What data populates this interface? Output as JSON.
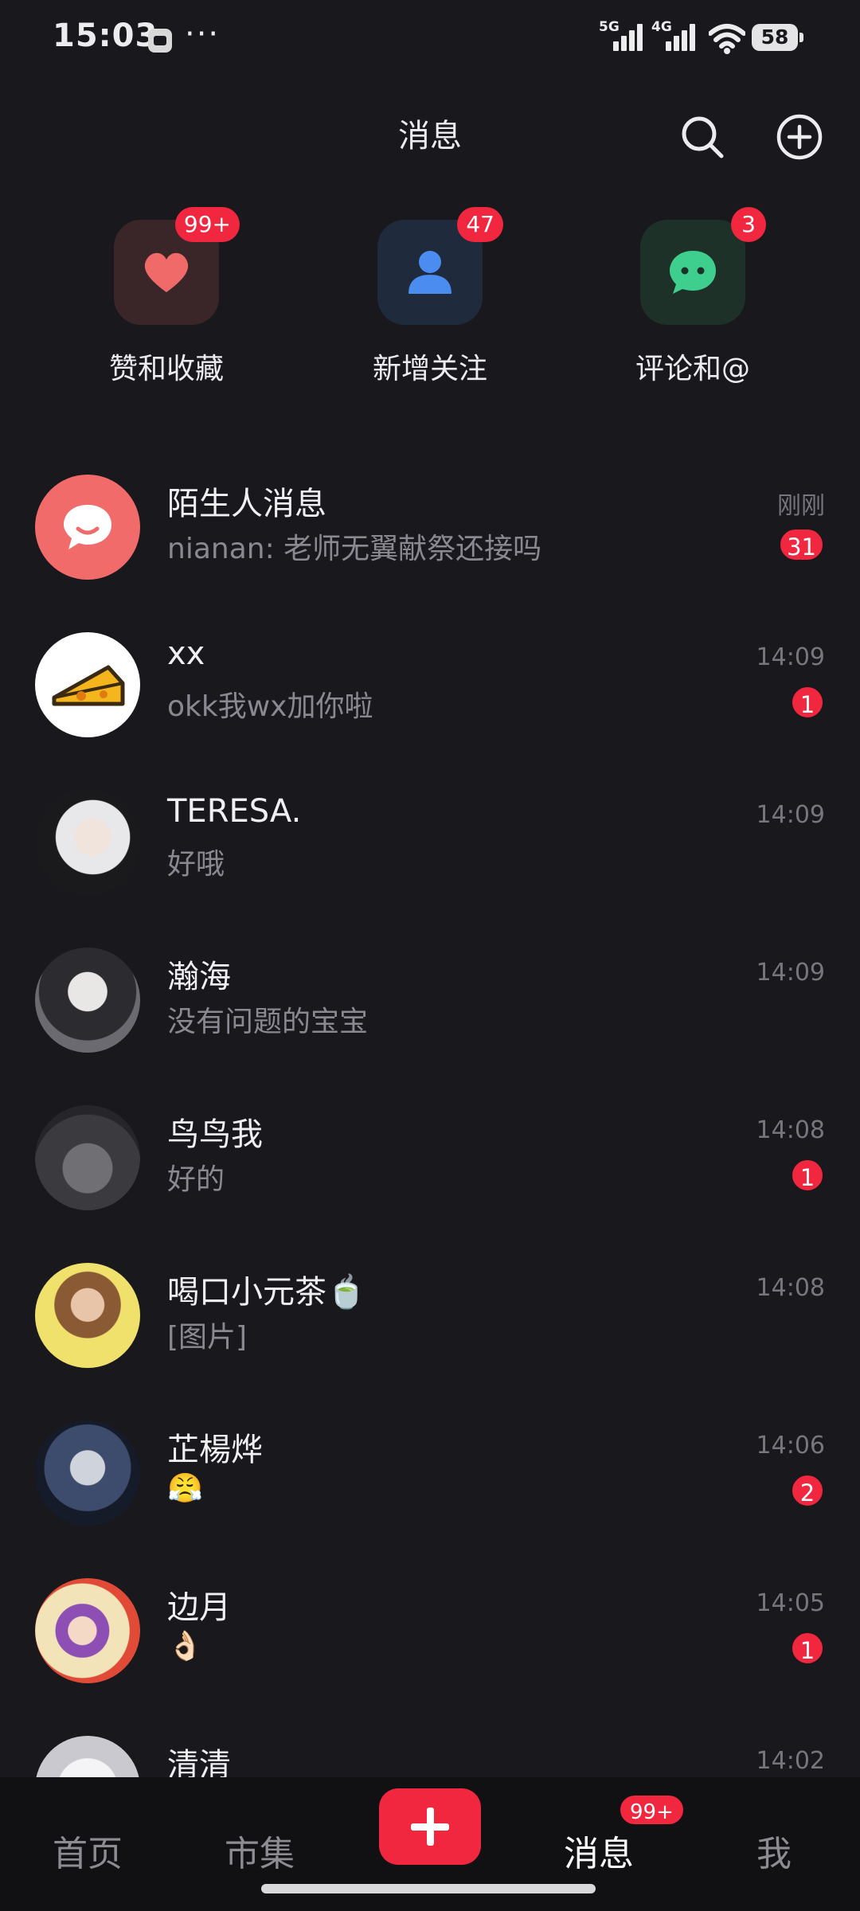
{
  "status_bar": {
    "time": "15:03",
    "dots": "···",
    "network1": "5G",
    "network2": "4G",
    "battery": "58"
  },
  "header": {
    "title": "消息",
    "search_icon": "search-icon",
    "add_icon": "plus-circle-icon"
  },
  "quick_actions": [
    {
      "label": "赞和收藏",
      "badge": "99+",
      "icon": "heart-icon",
      "color": "#f06a6a",
      "bg": "#3a2628"
    },
    {
      "label": "新增关注",
      "badge": "47",
      "icon": "person-icon",
      "color": "#4b8cf0",
      "bg": "#1f2a3c"
    },
    {
      "label": "评论和@",
      "badge": "3",
      "icon": "chat-bubble-icon",
      "color": "#3ecf8e",
      "bg": "#1d3129"
    }
  ],
  "conversations": [
    {
      "name": "陌生人消息",
      "message": "nianan: 老师无翼献祭还接吗",
      "time": "刚刚",
      "badge": "31"
    },
    {
      "name": "xx",
      "message": "okk我wx加你啦",
      "time": "14:09",
      "badge": "1"
    },
    {
      "name": "TERESA.",
      "message": "好哦",
      "time": "14:09",
      "badge": ""
    },
    {
      "name": "瀚海",
      "message": "没有问题的宝宝",
      "time": "14:09",
      "badge": ""
    },
    {
      "name": "鸟鸟我",
      "message": "好的",
      "time": "14:08",
      "badge": "1"
    },
    {
      "name": "喝口小元茶🍵",
      "message": "[图片]",
      "time": "14:08",
      "badge": ""
    },
    {
      "name": "芷楊烨",
      "message": "😤",
      "time": "14:06",
      "badge": "2"
    },
    {
      "name": "边月",
      "message": "👌🏻",
      "time": "14:05",
      "badge": "1"
    },
    {
      "name": "清清",
      "message": "",
      "time": "14:02",
      "badge": ""
    }
  ],
  "bottom_nav": {
    "home": "首页",
    "market": "市集",
    "messages": "消息",
    "messages_badge": "99+",
    "me": "我"
  },
  "colors": {
    "background": "#19181d",
    "accent": "#f1263f",
    "nav_bg": "#111013"
  }
}
